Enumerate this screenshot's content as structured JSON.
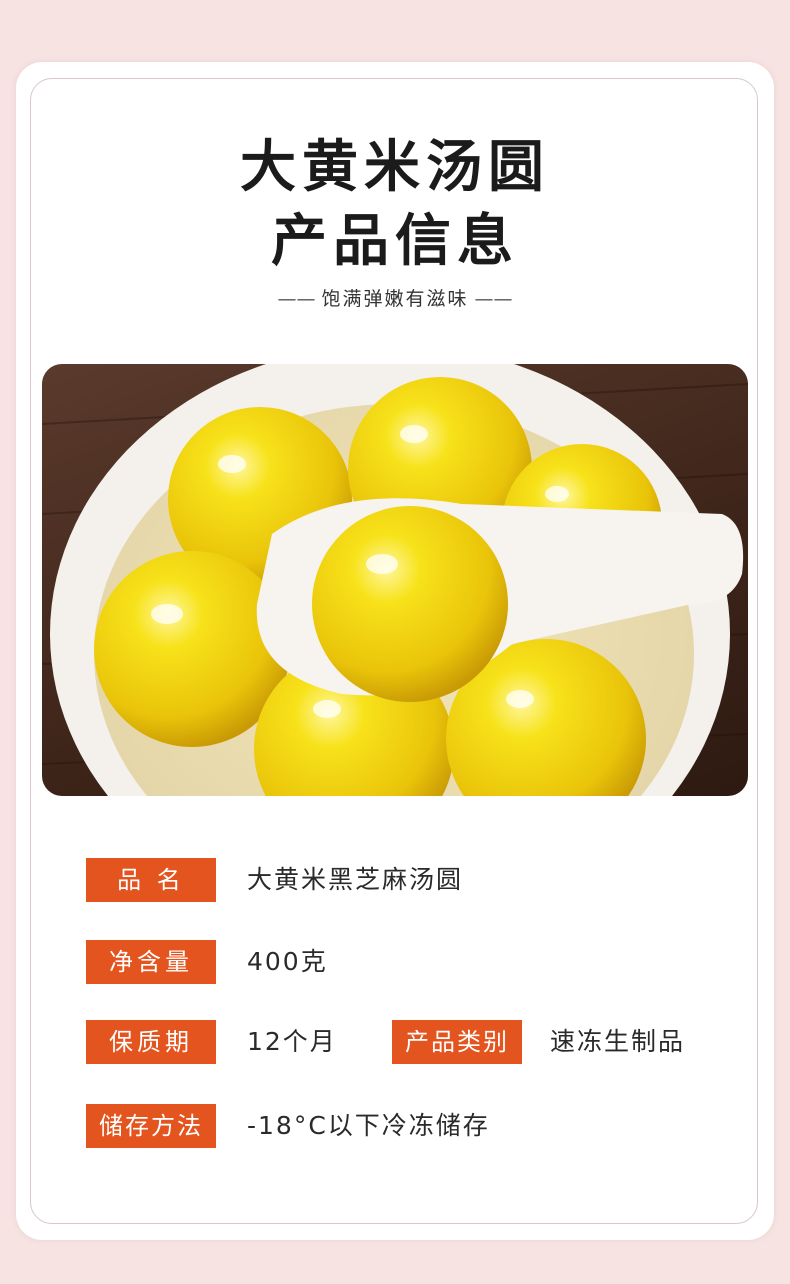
{
  "header": {
    "title_line1": "大黄米汤圆",
    "title_line2": "产品信息",
    "subtitle": "饱满弹嫩有滋味",
    "subtitle_dash_left": "—— ",
    "subtitle_dash_right": " ——"
  },
  "image": {
    "subject": "bowl-of-yellow-glutinous-rice-balls"
  },
  "specs": {
    "name_label": "品 名",
    "name_value": "大黄米黑芝麻汤圆",
    "net_label": "净含量",
    "net_value": "400克",
    "shelf_label": "保质期",
    "shelf_value": "12个月",
    "category_label": "产品类别",
    "category_value": "速冻生制品",
    "storage_label": "储存方法",
    "storage_value": "-18°C以下冷冻储存"
  },
  "colors": {
    "accent": "#e3541f",
    "background": "#f6e3e2"
  }
}
